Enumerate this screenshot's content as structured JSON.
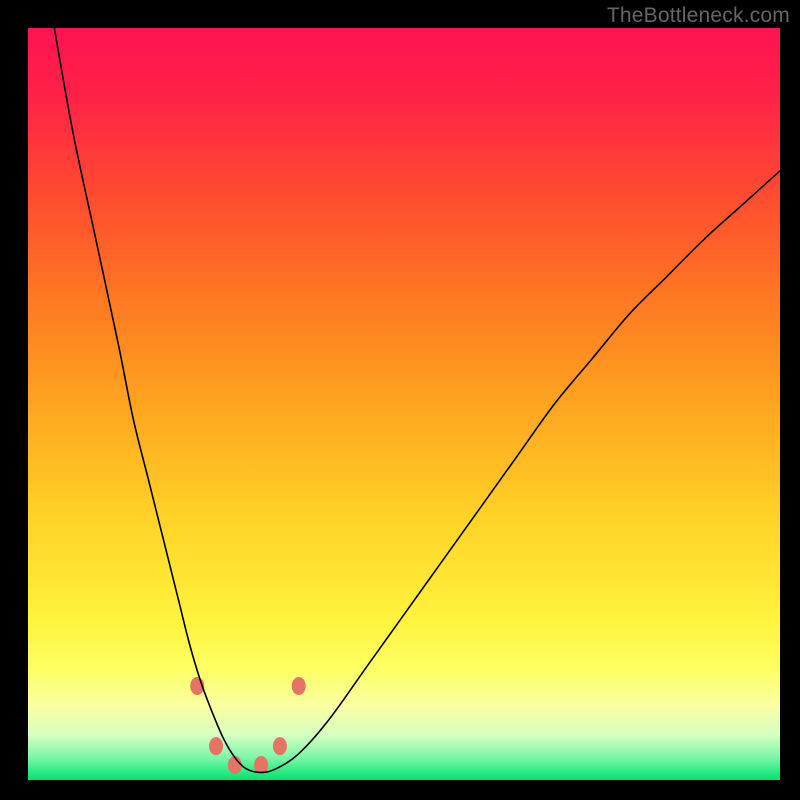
{
  "watermark": "TheBottleneck.com",
  "chart_data": {
    "type": "line",
    "title": "",
    "xlabel": "",
    "ylabel": "",
    "xlim": [
      0,
      100
    ],
    "ylim": [
      0,
      100
    ],
    "grid": false,
    "legend": false,
    "background_gradient_stops": [
      {
        "offset": 0.0,
        "color": "#ff1352"
      },
      {
        "offset": 0.08,
        "color": "#ff1f49"
      },
      {
        "offset": 0.2,
        "color": "#ff4432"
      },
      {
        "offset": 0.35,
        "color": "#ff7522"
      },
      {
        "offset": 0.5,
        "color": "#ffa41f"
      },
      {
        "offset": 0.65,
        "color": "#ffd227"
      },
      {
        "offset": 0.78,
        "color": "#fff23a"
      },
      {
        "offset": 0.85,
        "color": "#fdff60"
      },
      {
        "offset": 0.9,
        "color": "#fbffa0"
      },
      {
        "offset": 0.94,
        "color": "#d6ffc0"
      },
      {
        "offset": 0.97,
        "color": "#7bf7a8"
      },
      {
        "offset": 1.0,
        "color": "#00e36e"
      }
    ],
    "series": [
      {
        "name": "bottleneck-curve",
        "color": "#000000",
        "width": 1.6,
        "x": [
          3.5,
          6,
          9,
          12,
          14,
          16,
          18,
          20,
          21.5,
          23,
          24.5,
          26,
          27.5,
          29,
          31,
          33,
          36,
          40,
          45,
          50,
          55,
          60,
          65,
          70,
          75,
          80,
          85,
          90,
          95,
          100
        ],
        "values": [
          100,
          86,
          72,
          58,
          48,
          40,
          32,
          24,
          18,
          13,
          9,
          5.5,
          3,
          1.5,
          1,
          1.5,
          3.5,
          8,
          15,
          22,
          29,
          36,
          43,
          50,
          56,
          62,
          67,
          72,
          76.5,
          81
        ]
      }
    ],
    "markers": {
      "name": "highlight-dots",
      "color": "#e77365",
      "radius_x": 7,
      "radius_y": 9,
      "points": [
        {
          "x": 22.5,
          "y": 12.5
        },
        {
          "x": 25.0,
          "y": 4.5
        },
        {
          "x": 27.5,
          "y": 2.0
        },
        {
          "x": 31.0,
          "y": 2.0
        },
        {
          "x": 33.5,
          "y": 4.5
        },
        {
          "x": 36.0,
          "y": 12.5
        }
      ]
    }
  }
}
